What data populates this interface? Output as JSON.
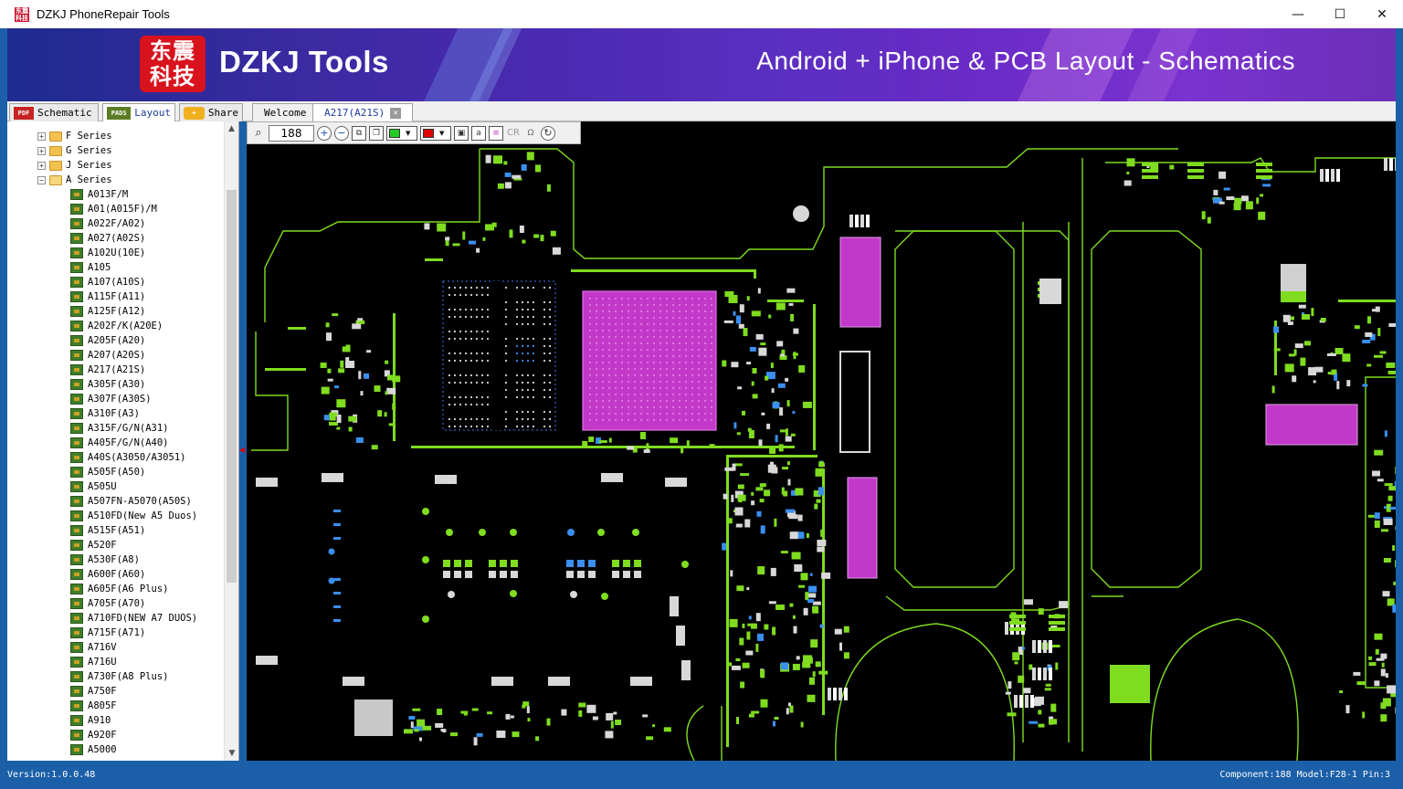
{
  "window": {
    "title": "DZKJ PhoneRepair Tools",
    "minimize": "—",
    "maximize": "☐",
    "close": "✕"
  },
  "banner": {
    "logo_line1": "东震",
    "logo_line2": "科技",
    "brand": "DZKJ Tools",
    "slogan": "Android + iPhone & PCB Layout - Schematics"
  },
  "mode_tabs": [
    {
      "label": "Schematic",
      "icon": "pdf-icon",
      "icon_text": "PDF"
    },
    {
      "label": "Layout",
      "icon": "pads-icon",
      "icon_text": "PADS"
    },
    {
      "label": "Share",
      "icon": "share-icon",
      "icon_text": ""
    }
  ],
  "doc_tabs": [
    {
      "label": "Welcome"
    },
    {
      "label": "A217(A21S)"
    }
  ],
  "tree": {
    "folders": [
      "F Series",
      "G Series",
      "J Series",
      "A Series"
    ],
    "items": [
      "A013F/M",
      "A01(A015F)/M",
      "A022F/A02)",
      "A027(A02S)",
      "A102U(10E)",
      "A105",
      "A107(A10S)",
      "A115F(A11)",
      "A125F(A12)",
      "A202F/K(A20E)",
      "A205F(A20)",
      "A207(A20S)",
      "A217(A21S)",
      "A305F(A30)",
      "A307F(A30S)",
      "A310F(A3)",
      "A315F/G/N(A31)",
      "A405F/G/N(A40)",
      "A40S(A3050/A3051)",
      "A505F(A50)",
      "A505U",
      "A507FN-A5070(A50S)",
      "A510FD(New A5 Duos)",
      "A515F(A51)",
      "A520F",
      "A530F(A8)",
      "A600F(A60)",
      "A605F(A6 Plus)",
      "A705F(A70)",
      "A710FD(NEW A7 DUOS)",
      "A715F(A71)",
      "A716V",
      "A716U",
      "A730F(A8 Plus)",
      "A750F",
      "A805F",
      "A910",
      "A920F",
      "A5000"
    ]
  },
  "toolbar": {
    "zoom_value": "188",
    "fill_color": "#22cc22",
    "line_color": "#e00000",
    "cr_label": "CR",
    "ohm_label": "Ω"
  },
  "colors": {
    "trace": "#7fdc1f",
    "chip": "#c238c8",
    "pad": "#d8d8d8",
    "via": "#3a8ff0"
  },
  "status": {
    "version": "Version:1.0.0.48",
    "info": "Component:188 Model:F28-1 Pin:3"
  }
}
